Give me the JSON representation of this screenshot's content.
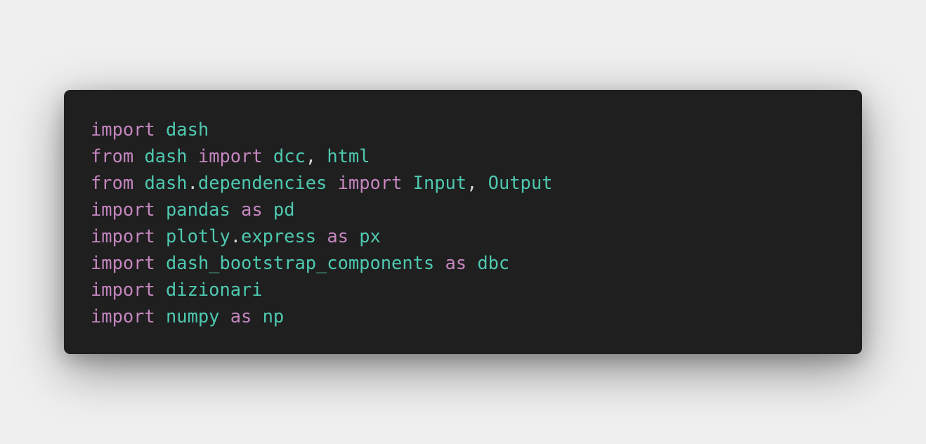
{
  "colors": {
    "page_background": "#efefef",
    "card_background": "#1f1f1f",
    "keyword": "#c586c0",
    "name": "#4ec9b0",
    "punctuation": "#d4d4d4"
  },
  "code": {
    "language": "python",
    "lines": [
      [
        {
          "text": "import",
          "kind": "keyword"
        },
        {
          "text": " ",
          "kind": "space"
        },
        {
          "text": "dash",
          "kind": "name"
        }
      ],
      [
        {
          "text": "from",
          "kind": "keyword"
        },
        {
          "text": " ",
          "kind": "space"
        },
        {
          "text": "dash",
          "kind": "name"
        },
        {
          "text": " ",
          "kind": "space"
        },
        {
          "text": "import",
          "kind": "keyword"
        },
        {
          "text": " ",
          "kind": "space"
        },
        {
          "text": "dcc",
          "kind": "name"
        },
        {
          "text": ", ",
          "kind": "punctuation"
        },
        {
          "text": "html",
          "kind": "name"
        }
      ],
      [
        {
          "text": "from",
          "kind": "keyword"
        },
        {
          "text": " ",
          "kind": "space"
        },
        {
          "text": "dash",
          "kind": "name"
        },
        {
          "text": ".",
          "kind": "punctuation"
        },
        {
          "text": "dependencies",
          "kind": "name"
        },
        {
          "text": " ",
          "kind": "space"
        },
        {
          "text": "import",
          "kind": "keyword"
        },
        {
          "text": " ",
          "kind": "space"
        },
        {
          "text": "Input",
          "kind": "name"
        },
        {
          "text": ", ",
          "kind": "punctuation"
        },
        {
          "text": "Output",
          "kind": "name"
        }
      ],
      [
        {
          "text": "import",
          "kind": "keyword"
        },
        {
          "text": " ",
          "kind": "space"
        },
        {
          "text": "pandas",
          "kind": "name"
        },
        {
          "text": " ",
          "kind": "space"
        },
        {
          "text": "as",
          "kind": "keyword"
        },
        {
          "text": " ",
          "kind": "space"
        },
        {
          "text": "pd",
          "kind": "name"
        }
      ],
      [
        {
          "text": "import",
          "kind": "keyword"
        },
        {
          "text": " ",
          "kind": "space"
        },
        {
          "text": "plotly",
          "kind": "name"
        },
        {
          "text": ".",
          "kind": "punctuation"
        },
        {
          "text": "express",
          "kind": "name"
        },
        {
          "text": " ",
          "kind": "space"
        },
        {
          "text": "as",
          "kind": "keyword"
        },
        {
          "text": " ",
          "kind": "space"
        },
        {
          "text": "px",
          "kind": "name"
        }
      ],
      [
        {
          "text": "import",
          "kind": "keyword"
        },
        {
          "text": " ",
          "kind": "space"
        },
        {
          "text": "dash_bootstrap_components",
          "kind": "name"
        },
        {
          "text": " ",
          "kind": "space"
        },
        {
          "text": "as",
          "kind": "keyword"
        },
        {
          "text": " ",
          "kind": "space"
        },
        {
          "text": "dbc",
          "kind": "name"
        }
      ],
      [
        {
          "text": "import",
          "kind": "keyword"
        },
        {
          "text": " ",
          "kind": "space"
        },
        {
          "text": "dizionari",
          "kind": "name"
        }
      ],
      [
        {
          "text": "import",
          "kind": "keyword"
        },
        {
          "text": " ",
          "kind": "space"
        },
        {
          "text": "numpy",
          "kind": "name"
        },
        {
          "text": " ",
          "kind": "space"
        },
        {
          "text": "as",
          "kind": "keyword"
        },
        {
          "text": " ",
          "kind": "space"
        },
        {
          "text": "np",
          "kind": "name"
        }
      ]
    ]
  }
}
